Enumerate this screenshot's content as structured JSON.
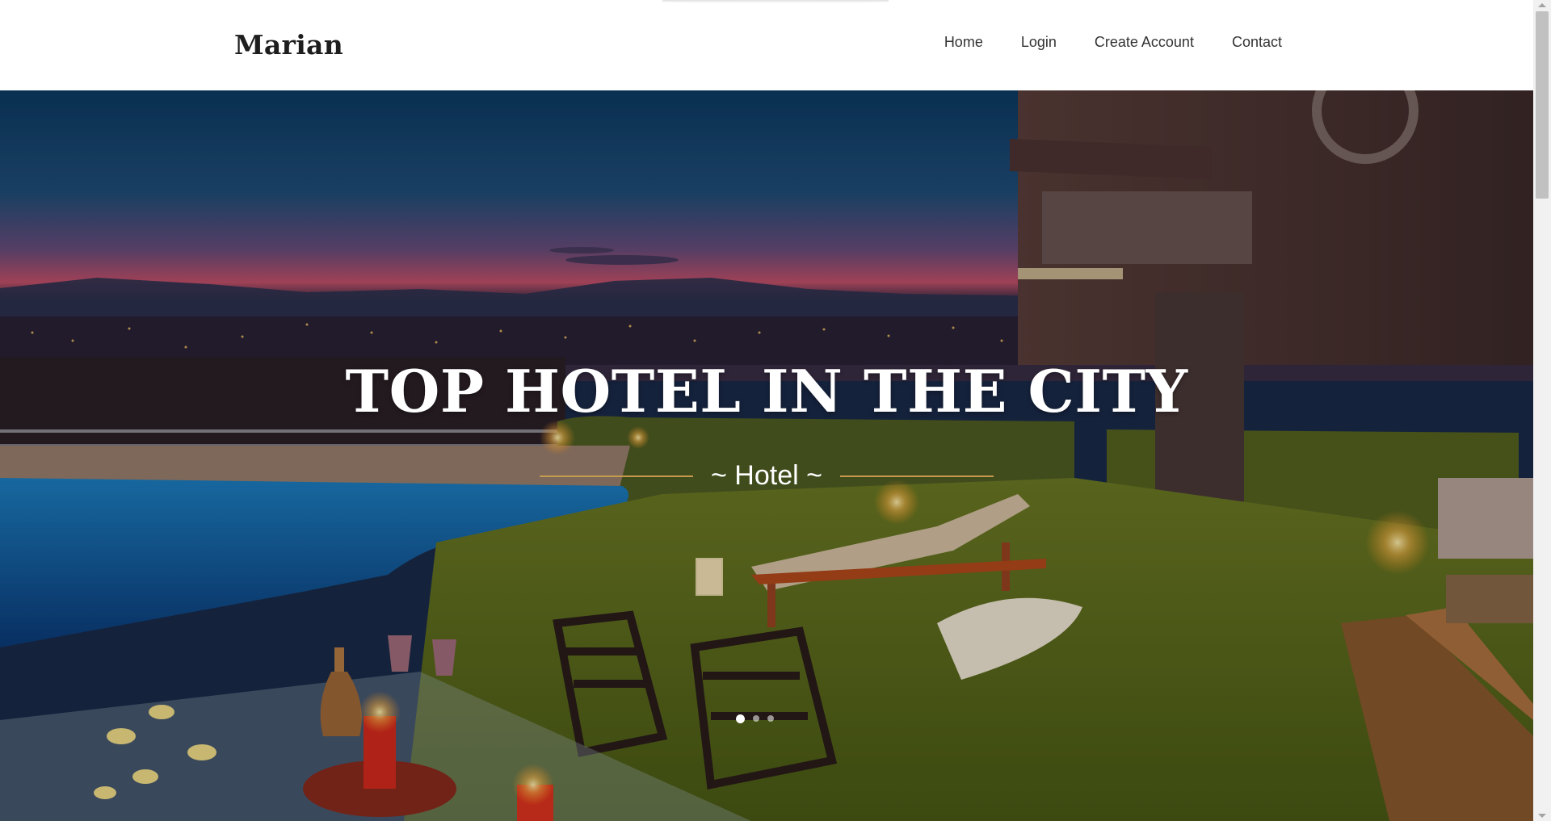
{
  "header": {
    "logo": "Marian",
    "nav": [
      {
        "label": "Home"
      },
      {
        "label": "Login"
      },
      {
        "label": "Create Account"
      },
      {
        "label": "Contact"
      }
    ]
  },
  "hero": {
    "title": "TOP HOTEL IN THE CITY",
    "subtitle": "~ Hotel ~",
    "slides_count": 3,
    "active_slide": 1,
    "image": "hotel-pool-terrace-at-dusk"
  },
  "colors": {
    "accent_line": "#c59a4f",
    "logo_text": "#1e1e1e",
    "nav_text": "#333333"
  }
}
